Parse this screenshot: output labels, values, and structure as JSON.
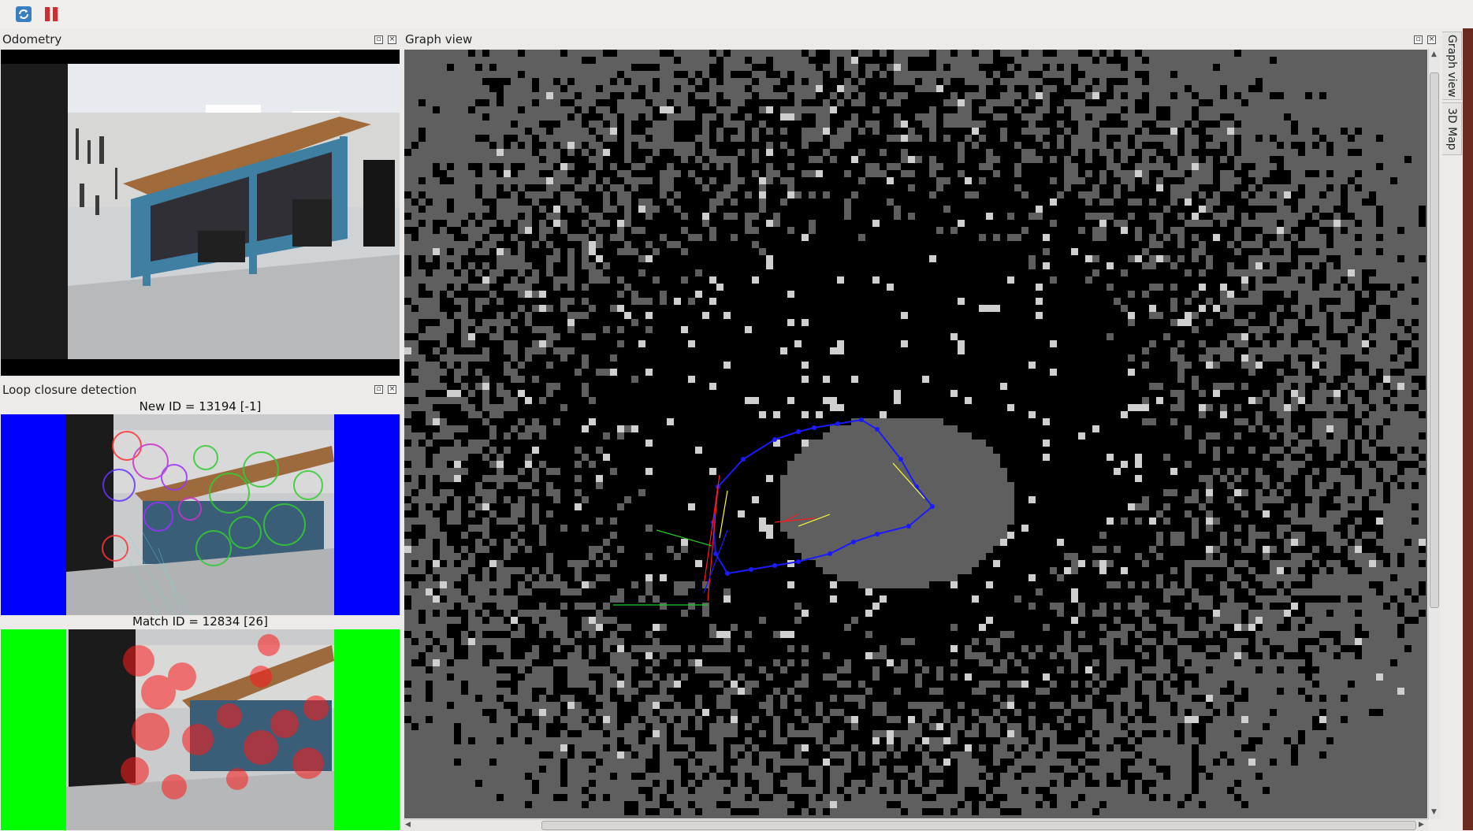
{
  "toolbar": {
    "refresh_icon": "refresh-icon",
    "pause_icon": "pause-icon"
  },
  "docks": {
    "odometry": {
      "title": "Odometry"
    },
    "loop_closure": {
      "title": "Loop closure detection",
      "new_id_label": "New ID = 13194 [-1]",
      "match_id_label": "Match ID = 12834 [26]"
    },
    "graph_view": {
      "title": "Graph view"
    }
  },
  "side_tabs": {
    "graph_view": "Graph view",
    "map_3d": "3D Map"
  },
  "colors": {
    "new_frame_border": "#0000ff",
    "match_frame_border": "#00ff00",
    "graph_background": "#5f5f5f",
    "occupied": "#000000",
    "trajectory": "#1a1aff",
    "link_red": "#ff1a1a",
    "link_yellow": "#ffff33",
    "link_green": "#22cc22"
  }
}
